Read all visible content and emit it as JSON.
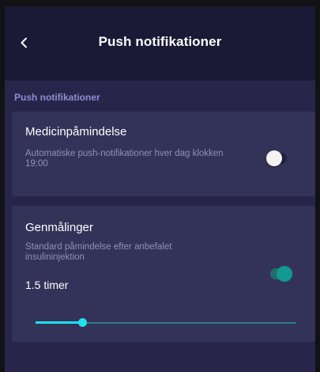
{
  "header": {
    "title": "Push notifikationer",
    "back_icon": "chevron-left-icon"
  },
  "section": {
    "label": "Push notifikationer"
  },
  "cards": [
    {
      "title": "Medicinpåmindelse",
      "description": "Automatiske push-notifikationer hver dag klokken\n19:00",
      "toggle_on": false
    },
    {
      "title": "Genmålinger",
      "description": "Standard påmindelse efter anbefalet insulininjektion",
      "value": "1.5 timer",
      "toggle_on": true,
      "slider_fraction": 0.18
    }
  ],
  "colors": {
    "background": "#27264a",
    "header": "#1a1a36",
    "card": "#333359",
    "section_label": "#8c8dd6",
    "accent_teal": "#12998f",
    "slider_cyan": "#22e0ee"
  }
}
